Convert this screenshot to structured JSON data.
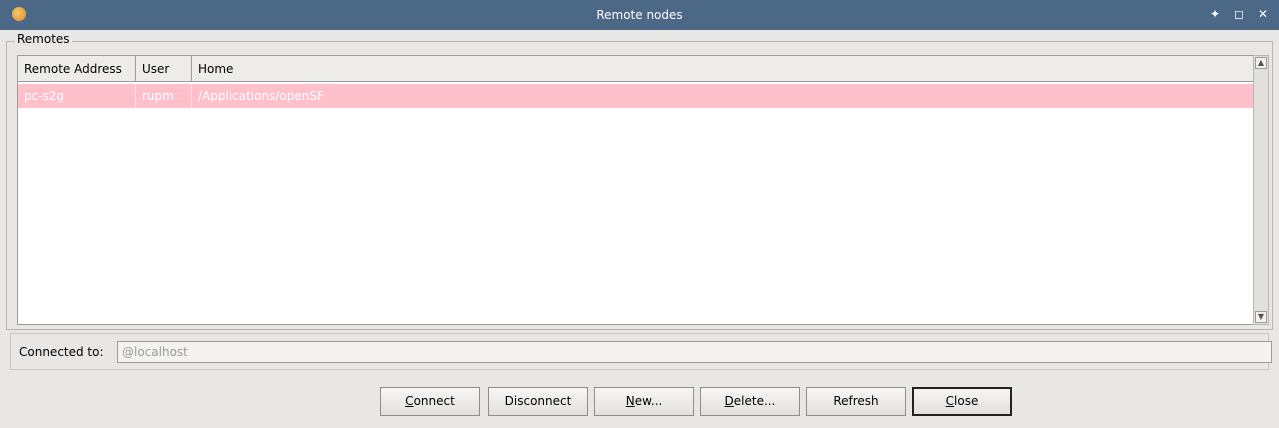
{
  "window": {
    "title": "Remote nodes",
    "controls": [
      "✦",
      "◻",
      "✕"
    ]
  },
  "remotes": {
    "group_label": "Remotes",
    "columns": [
      "Remote Address",
      "User",
      "Home"
    ],
    "rows": [
      {
        "address": "pc-s2g",
        "user": "rupm",
        "home": "/Applications/openSF"
      }
    ]
  },
  "connected": {
    "label": "Connected to:",
    "value": "@localhost"
  },
  "buttons": {
    "connect": {
      "mnemonic": "C",
      "rest": "onnect"
    },
    "disconnect": "Disconnect",
    "new": {
      "mnemonic": "N",
      "rest": "ew..."
    },
    "delete": {
      "mnemonic": "D",
      "rest": "elete..."
    },
    "refresh": "Refresh",
    "close": {
      "mnemonic": "C",
      "rest": "lose"
    }
  }
}
